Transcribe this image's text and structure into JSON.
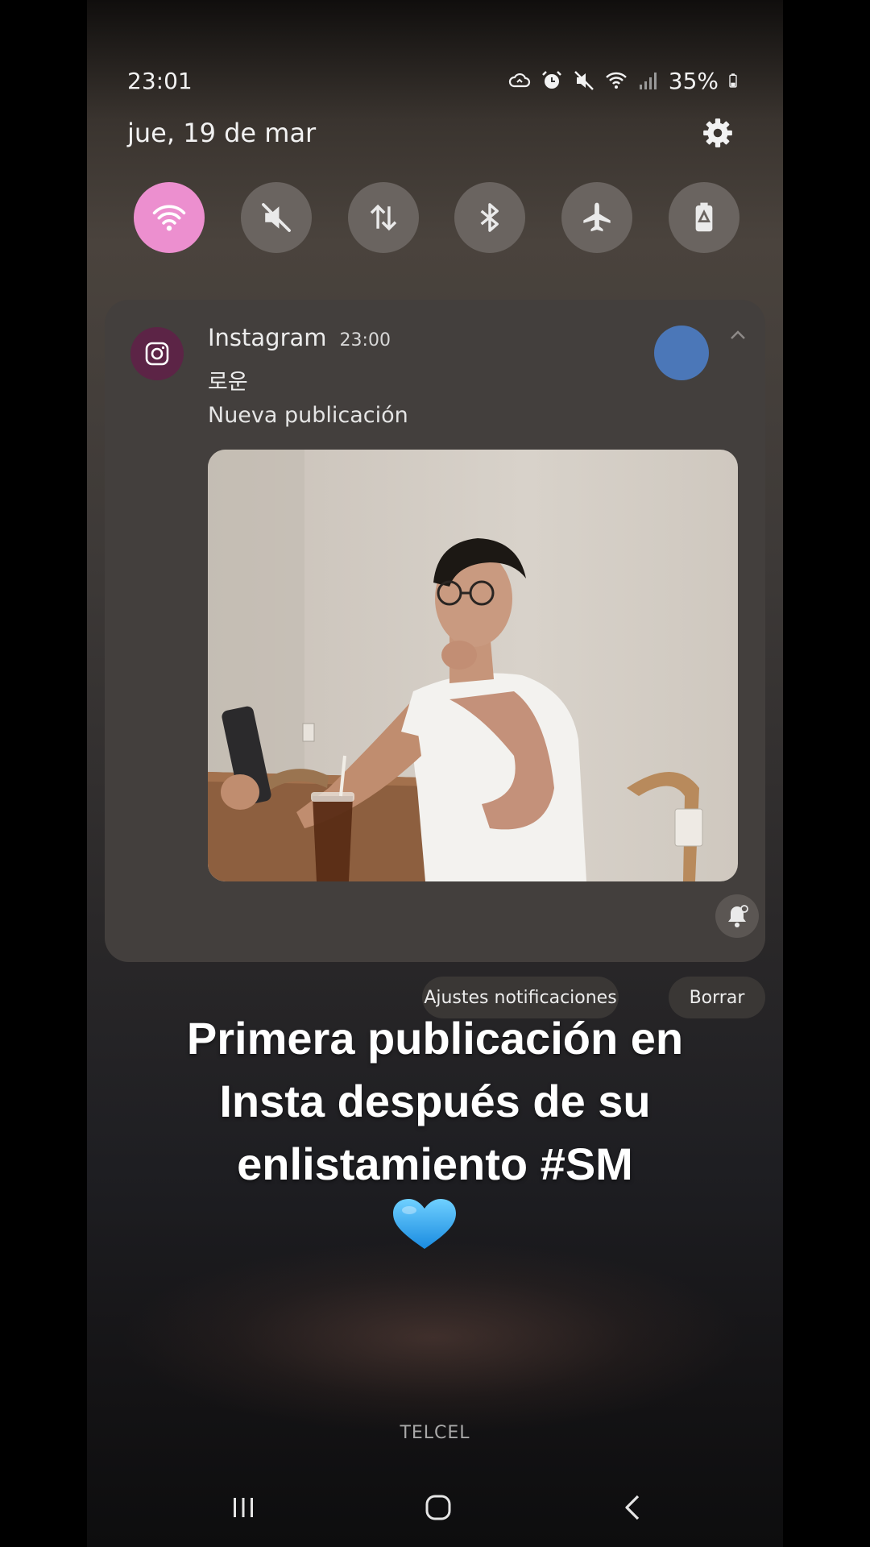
{
  "status_bar": {
    "time": "23:01",
    "battery_percent": "35%",
    "icons": [
      "cloud-sync-icon",
      "alarm-icon",
      "mute-icon",
      "wifi-icon",
      "signal-icon",
      "battery-icon"
    ]
  },
  "header": {
    "date": "jue, 19 de mar",
    "settings_icon": "gear-icon"
  },
  "quick_settings": [
    {
      "name": "wifi",
      "icon": "wifi-icon",
      "active": true
    },
    {
      "name": "sound",
      "icon": "mute-icon",
      "active": false
    },
    {
      "name": "mobile-data",
      "icon": "data-transfer-icon",
      "active": false
    },
    {
      "name": "bluetooth",
      "icon": "bluetooth-icon",
      "active": false
    },
    {
      "name": "airplane-mode",
      "icon": "airplane-icon",
      "active": false
    },
    {
      "name": "power-saving",
      "icon": "battery-saver-icon",
      "active": false
    }
  ],
  "notification": {
    "app_name": "Instagram",
    "time": "23:00",
    "sender": "로운",
    "text": "Nueva publicación",
    "accent": "#ec8fcf",
    "avatar_color": "#4b77b8"
  },
  "actions": {
    "settings_label": "Ajustes notificaciones",
    "clear_label": "Borrar"
  },
  "caption": {
    "line1": "Primera publicación en",
    "line2": "Insta después de su",
    "line3": "enlistamiento #SM",
    "emoji": "blue-heart"
  },
  "carrier": "TELCEL",
  "navbar": {
    "buttons": [
      "recents-icon",
      "home-icon",
      "back-icon"
    ]
  }
}
